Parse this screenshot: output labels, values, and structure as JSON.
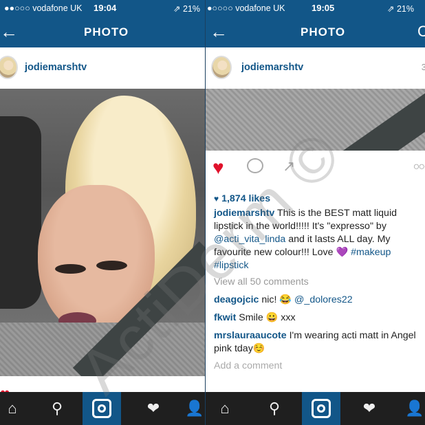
{
  "left": {
    "status": {
      "carrier": "●●○○○ vodafone UK",
      "time": "19:04",
      "battery": "⇗ 21%"
    },
    "nav": {
      "title": "PHOTO",
      "back": "←"
    },
    "post": {
      "username": "jodiemarshtv"
    }
  },
  "right": {
    "status": {
      "carrier": "●○○○○ vodafone UK",
      "time": "19:05",
      "battery": "⇗ 21%"
    },
    "nav": {
      "title": "PHOTO",
      "back": "←"
    },
    "post": {
      "username": "jodiemarshtv",
      "time_fragment": "3",
      "likes": "1,874 likes",
      "caption": {
        "user": "jodiemarshtv",
        "text1": " This is the BEST matt liquid lipstick in the world!!!!! It's \"expresso\" by ",
        "mention": "@acti_vita_linda",
        "text2": " and it lasts ALL day. My favourite new colour!!! Love 💜 ",
        "tag1": "#makeup",
        "tag2": "#lipstick"
      },
      "view_all": "View all 50 comments",
      "comments": [
        {
          "user": "deagojcic",
          "text": " nic! 😂 ",
          "mention": "@_dolores22"
        },
        {
          "user": "fkwit",
          "text": " Smile 😀 xxx",
          "mention": ""
        },
        {
          "user": "mrslauraaucote",
          "text": " I'm wearing acti matt in Angel pink tday☺️",
          "mention": ""
        }
      ],
      "add_comment": "Add a comment"
    }
  },
  "watermark": "ActiDerm ©"
}
